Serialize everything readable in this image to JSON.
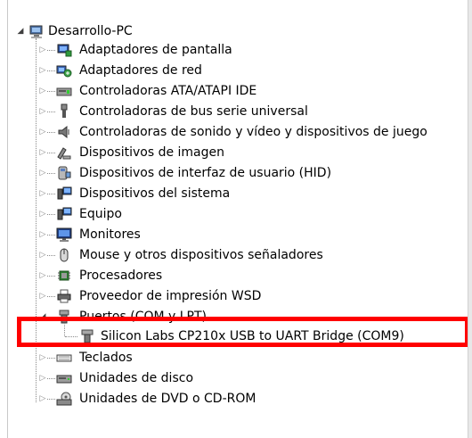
{
  "tree": {
    "root": {
      "label": "Desarrollo-PC",
      "icon": "computer-icon",
      "expander": "expanded"
    },
    "items": [
      {
        "label": "Adaptadores de pantalla",
        "icon": "display-adapter-icon"
      },
      {
        "label": "Adaptadores de red",
        "icon": "network-adapter-icon"
      },
      {
        "label": "Controladoras ATA/ATAPI IDE",
        "icon": "ide-controller-icon"
      },
      {
        "label": "Controladoras de bus serie universal",
        "icon": "usb-controller-icon"
      },
      {
        "label": "Controladoras de sonido y vídeo y dispositivos de juego",
        "icon": "speaker-icon"
      },
      {
        "label": "Dispositivos de imagen",
        "icon": "camera-icon"
      },
      {
        "label": "Dispositivos de interfaz de usuario (HID)",
        "icon": "hid-device-icon"
      },
      {
        "label": "Dispositivos del sistema",
        "icon": "system-device-icon"
      },
      {
        "label": "Equipo",
        "icon": "computer-icon"
      },
      {
        "label": "Monitores",
        "icon": "monitor-icon"
      },
      {
        "label": "Mouse y otros dispositivos señaladores",
        "icon": "mouse-icon"
      },
      {
        "label": "Procesadores",
        "icon": "processor-icon"
      },
      {
        "label": "Proveedor de impresión WSD",
        "icon": "printer-icon"
      },
      {
        "label": "Puertos (COM y LPT)",
        "icon": "port-icon",
        "expanded": true
      },
      {
        "label": "Silicon Labs CP210x USB to UART Bridge (COM9)",
        "icon": "serial-port-icon",
        "child": true
      },
      {
        "label": "Teclados",
        "icon": "keyboard-icon"
      },
      {
        "label": "Unidades de disco",
        "icon": "disk-drive-icon"
      },
      {
        "label": "Unidades de DVD o CD-ROM",
        "icon": "dvd-drive-icon"
      }
    ]
  },
  "colors": {
    "highlight": "#ff0000",
    "expander": "#8a8a8a"
  }
}
